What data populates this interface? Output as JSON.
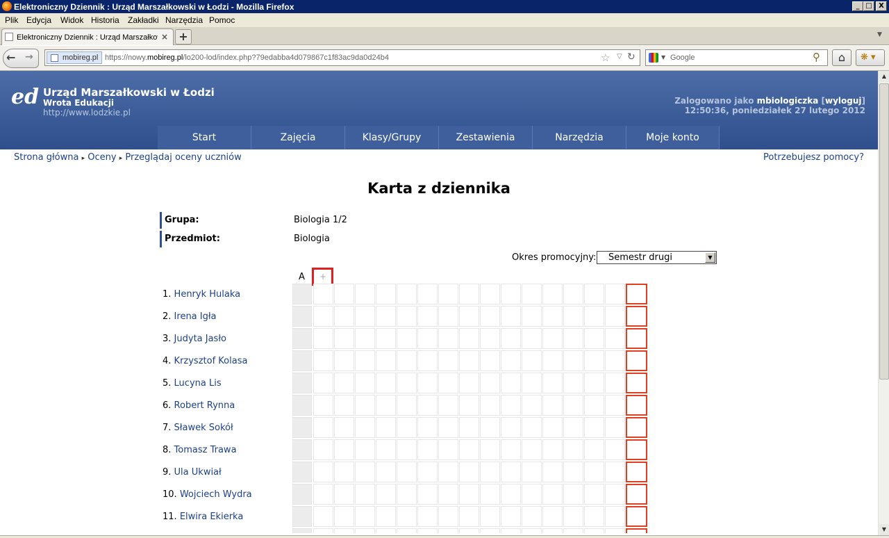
{
  "window": {
    "title": "Elektroniczny Dziennik : Urząd Marszałkowski w Łodzi - Mozilla Firefox",
    "minimize": "_",
    "maximize": "□",
    "close": "X"
  },
  "menu": [
    "Plik",
    "Edycja",
    "Widok",
    "Historia",
    "Zakładki",
    "Narzędzia",
    "Pomoc"
  ],
  "tab": {
    "label": "Elektroniczny Dziennik : Urząd Marszałkowski...",
    "close": "×",
    "new": "+"
  },
  "nav": {
    "site_badge": "mobireg.pl",
    "url_prefix": "https://nowy.",
    "url_domain": "mobireg.pl",
    "url_rest": "/lo200-lod/index.php?79edabba4d079867c1f83ac9da0d24b4",
    "search_placeholder": "Google"
  },
  "header": {
    "org": "Urząd Marszałkowski w Łodzi",
    "subtitle": "Wrota Edukacji",
    "website": "http://www.lodzkie.pl",
    "login_prefix": "Zalogowano jako",
    "username": "mbiologiczka",
    "logout": "wyloguj",
    "datetime": "12:50:36, poniedziałek 27 lutego 2012"
  },
  "main_menu": [
    "Start",
    "Zajęcia",
    "Klasy/Grupy",
    "Zestawienia",
    "Narzędzia",
    "Moje konto"
  ],
  "breadcrumb": [
    "Strona główna",
    "Oceny",
    "Przeglądaj oceny uczniów"
  ],
  "help_link": "Potrzebujesz pomocy?",
  "page_title": "Karta z dziennika",
  "info": {
    "group_label": "Grupa:",
    "group_value": "Biologia 1/2",
    "subject_label": "Przedmiot:",
    "subject_value": "Biologia"
  },
  "period": {
    "label": "Okres promocyjny:",
    "selected": "Semestr drugi"
  },
  "grid": {
    "column_a": "A",
    "add_column": "+"
  },
  "students": [
    {
      "num": "1.",
      "name": "Henryk Hulaka"
    },
    {
      "num": "2.",
      "name": "Irena Igła"
    },
    {
      "num": "3.",
      "name": "Judyta Jasło"
    },
    {
      "num": "4.",
      "name": "Krzysztof Kolasa"
    },
    {
      "num": "5.",
      "name": "Lucyna Lis"
    },
    {
      "num": "6.",
      "name": "Robert Rynna"
    },
    {
      "num": "7.",
      "name": "Sławek Sokół"
    },
    {
      "num": "8.",
      "name": "Tomasz Trawa"
    },
    {
      "num": "9.",
      "name": "Ula Ukwiał"
    },
    {
      "num": "10.",
      "name": "Wojciech Wydra"
    },
    {
      "num": "11.",
      "name": "Elwira Ekierka"
    }
  ]
}
